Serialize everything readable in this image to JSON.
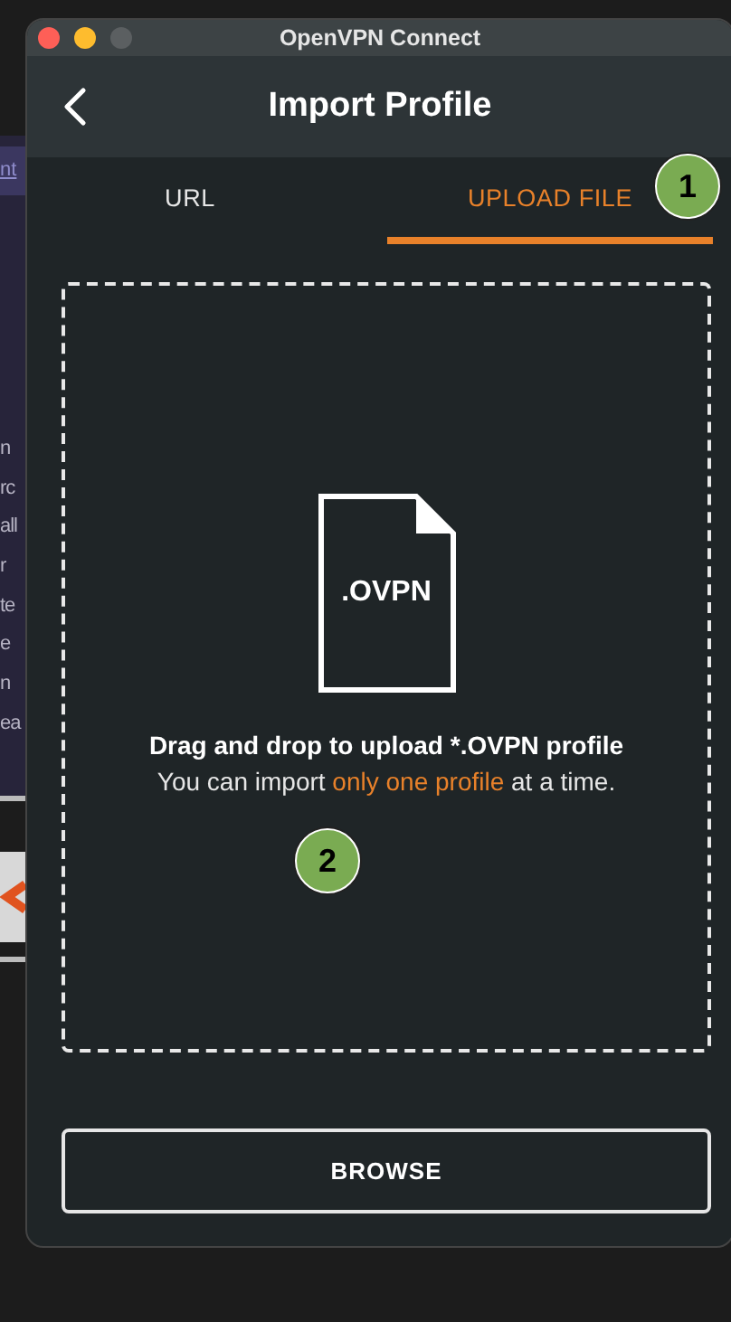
{
  "background_window": {
    "link": "nt",
    "lines": [
      "n",
      "rc",
      "all",
      "r",
      "te",
      "e",
      "n",
      "ea"
    ]
  },
  "window": {
    "title": "OpenVPN Connect"
  },
  "header": {
    "title": "Import Profile"
  },
  "tabs": [
    {
      "label": "URL",
      "selected": false
    },
    {
      "label": "UPLOAD FILE",
      "selected": true
    }
  ],
  "drop_zone": {
    "file_label": ".OVPN",
    "heading": "Drag and drop to upload *.OVPN profile",
    "note": [
      {
        "text": "You can import ",
        "highlight": false
      },
      {
        "text": "only one profile",
        "highlight": true
      },
      {
        "text": " at a time.",
        "highlight": false
      }
    ]
  },
  "annotations": [
    {
      "label": "1"
    },
    {
      "label": "2"
    }
  ],
  "buttons": [
    "BROWSE"
  ]
}
